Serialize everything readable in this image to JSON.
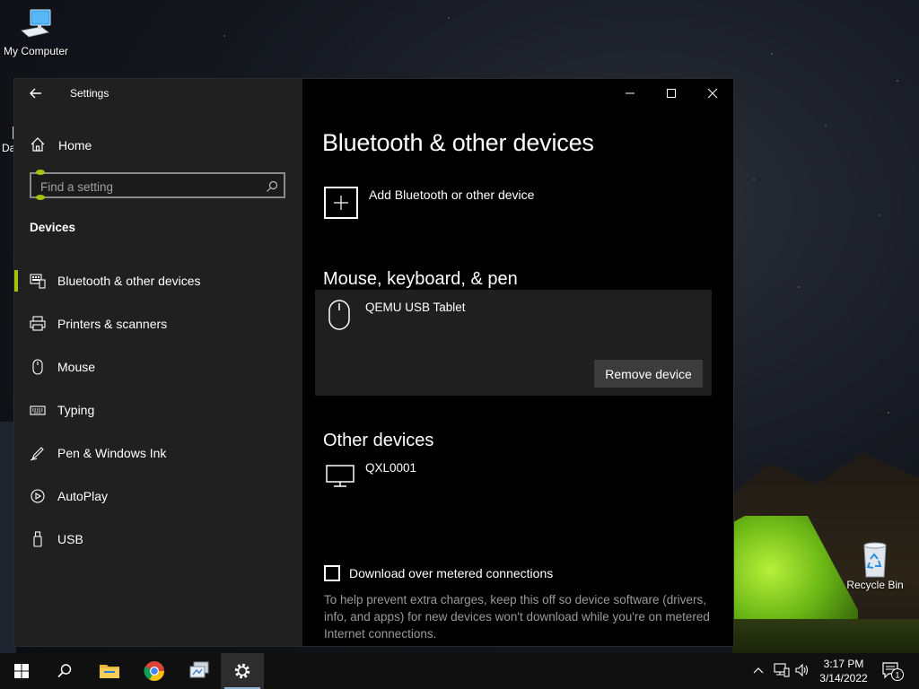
{
  "desktop": {
    "icons": {
      "my_computer": "My Computer",
      "recycle_bin": "Recycle Bin",
      "partial_label": "Da"
    }
  },
  "window": {
    "title": "Settings",
    "controls": {
      "minimize": "minimize-icon",
      "maximize": "maximize-icon",
      "close": "close-icon"
    }
  },
  "sidebar": {
    "home_label": "Home",
    "search_placeholder": "Find a setting",
    "section_title": "Devices",
    "items": [
      {
        "label": "Bluetooth & other devices",
        "icon": "bluetooth-devices-icon",
        "active": true
      },
      {
        "label": "Printers & scanners",
        "icon": "printer-icon",
        "active": false
      },
      {
        "label": "Mouse",
        "icon": "mouse-icon",
        "active": false
      },
      {
        "label": "Typing",
        "icon": "keyboard-icon",
        "active": false
      },
      {
        "label": "Pen & Windows Ink",
        "icon": "pen-icon",
        "active": false
      },
      {
        "label": "AutoPlay",
        "icon": "autoplay-icon",
        "active": false
      },
      {
        "label": "USB",
        "icon": "usb-icon",
        "active": false
      }
    ]
  },
  "main": {
    "heading": "Bluetooth & other devices",
    "add_device_label": "Add Bluetooth or other device",
    "mouse_section": {
      "title": "Mouse, keyboard, & pen",
      "device_name": "QEMU USB Tablet",
      "remove_label": "Remove device"
    },
    "other_section": {
      "title": "Other devices",
      "device_name": "QXL0001"
    },
    "metered": {
      "checkbox_label": "Download over metered connections",
      "checked": false,
      "help_text": "To help prevent extra charges, keep this off so device software (drivers, info, and apps) for new devices won't download while you're on metered Internet connections."
    }
  },
  "taskbar": {
    "time": "3:17 PM",
    "date": "3/14/2022",
    "notification_count": "1"
  },
  "colors": {
    "accent": "#a4c40a",
    "window_bg": "#000000",
    "sidebar_bg": "#202020",
    "card_bg": "#1f1f1f",
    "button_bg": "#3c3c3c",
    "muted_text": "#9a9a9a"
  }
}
